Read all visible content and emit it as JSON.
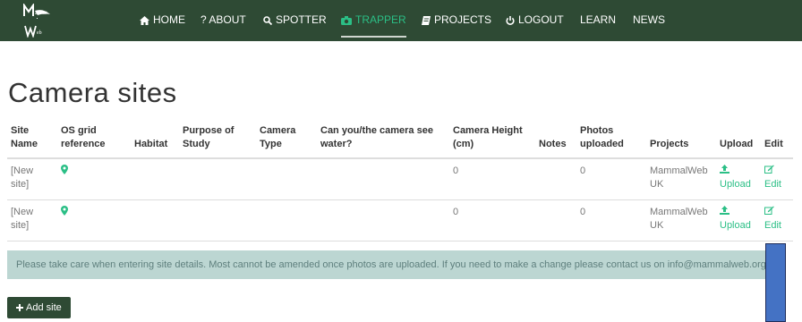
{
  "nav": {
    "items": [
      {
        "label": "HOME",
        "icon": "home-icon"
      },
      {
        "label": "? ABOUT",
        "icon": ""
      },
      {
        "label": "SPOTTER",
        "icon": "search-icon"
      },
      {
        "label": "TRAPPER",
        "icon": "camera-icon"
      },
      {
        "label": "PROJECTS",
        "icon": "book-icon"
      },
      {
        "label": "LOGOUT",
        "icon": "power-icon"
      },
      {
        "label": "LEARN",
        "icon": ""
      },
      {
        "label": "NEWS",
        "icon": ""
      }
    ],
    "active": "TRAPPER"
  },
  "page": {
    "title": "Camera sites"
  },
  "table": {
    "headers": [
      "Site Name",
      "OS grid reference",
      "Habitat",
      "Purpose of Study",
      "Camera Type",
      "Can you/the camera see water?",
      "Camera Height (cm)",
      "Notes",
      "Photos uploaded",
      "Projects",
      "Upload",
      "Edit"
    ],
    "rows": [
      {
        "site_name": "[New site]",
        "grid_ref_icon": "map-marker-icon",
        "habitat": "",
        "purpose": "",
        "camera_type": "",
        "water": "",
        "height": "0",
        "notes": "",
        "photos": "0",
        "projects": "MammalWeb UK",
        "upload": "Upload",
        "edit": "Edit"
      },
      {
        "site_name": "[New site]",
        "grid_ref_icon": "map-marker-icon",
        "habitat": "",
        "purpose": "",
        "camera_type": "",
        "water": "",
        "height": "0",
        "notes": "",
        "photos": "0",
        "projects": "MammalWeb UK",
        "upload": "Upload",
        "edit": "Edit"
      }
    ]
  },
  "notice": "Please take care when entering site details. Most cannot be amended once photos are uploaded. If you need to make a change please contact us on info@mammalweb.org.",
  "add_button": "Add site",
  "colors": {
    "navbar": "#2e4a34",
    "accent": "#2bbf86",
    "notice_bg": "#bcd6d2",
    "overlay": "#4472c4"
  }
}
